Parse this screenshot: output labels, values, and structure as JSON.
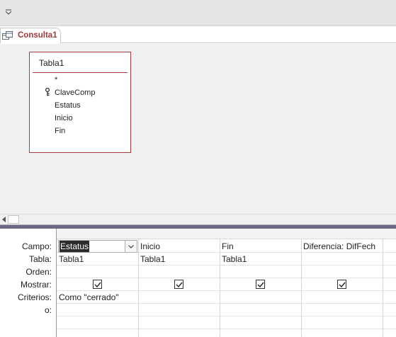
{
  "tab": {
    "label": "Consulta1"
  },
  "table": {
    "title": "Tabla1",
    "fields": [
      "*",
      "ClaveComp",
      "Estatus",
      "Inicio",
      "Fin"
    ]
  },
  "grid": {
    "row_labels": {
      "campo": "Campo:",
      "tabla": "Tabla:",
      "orden": "Orden:",
      "mostrar": "Mostrar:",
      "criterios": "Criterios:",
      "o": "o:"
    },
    "columns": [
      {
        "campo": "Estatus",
        "tabla": "Tabla1",
        "mostrar": true,
        "criterios": "Como \"cerrado\""
      },
      {
        "campo": "Inicio",
        "tabla": "Tabla1",
        "mostrar": true,
        "criterios": ""
      },
      {
        "campo": "Fin",
        "tabla": "Tabla1",
        "mostrar": true,
        "criterios": ""
      },
      {
        "campo": "Diferencia: DifFech",
        "tabla": "",
        "mostrar": true,
        "criterios": ""
      }
    ]
  },
  "colors": {
    "accent": "#a4373a",
    "table_border": "#b03a3a",
    "splitter": "#6e6a86"
  }
}
